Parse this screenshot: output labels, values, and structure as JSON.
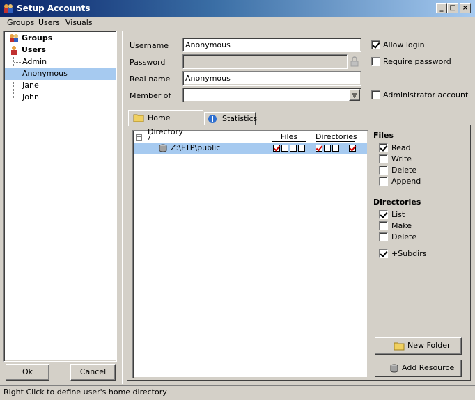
{
  "window": {
    "title": "Setup Accounts",
    "minimize": "_",
    "maximize": "□",
    "close": "×"
  },
  "menu": [
    "Groups",
    "Users",
    "Visuals"
  ],
  "tree": {
    "groups_label": "Groups",
    "users_label": "Users",
    "users": [
      "Admin",
      "Anonymous",
      "Jane",
      "John"
    ],
    "selected": "Anonymous"
  },
  "buttons": {
    "ok": "Ok",
    "cancel": "Cancel",
    "new_folder": "New Folder",
    "add_resource": "Add Resource"
  },
  "form": {
    "username_label": "Username",
    "username_value": "Anonymous",
    "password_label": "Password",
    "password_value": "",
    "realname_label": "Real name",
    "realname_value": "Anonymous",
    "memberof_label": "Member of",
    "memberof_value": "",
    "allow_login": {
      "label": "Allow login",
      "checked": true
    },
    "require_password": {
      "label": "Require password",
      "checked": false
    },
    "admin_account": {
      "label": "Administrator account",
      "checked": false
    }
  },
  "tabs": [
    "Home Directory",
    "Statistics"
  ],
  "dir_list": {
    "root": "/",
    "col_files": "Files",
    "col_dirs": "Directories",
    "entries": [
      {
        "path": "Z:\\FTP\\public",
        "files": [
          true,
          false,
          false,
          false
        ],
        "dirs": [
          true,
          false,
          false,
          true
        ]
      }
    ]
  },
  "perms": {
    "files_header": "Files",
    "files": [
      {
        "label": "Read",
        "checked": true
      },
      {
        "label": "Write",
        "checked": false
      },
      {
        "label": "Delete",
        "checked": false
      },
      {
        "label": "Append",
        "checked": false
      }
    ],
    "dirs_header": "Directories",
    "dirs": [
      {
        "label": "List",
        "checked": true
      },
      {
        "label": "Make",
        "checked": false
      },
      {
        "label": "Delete",
        "checked": false
      }
    ],
    "subdirs": {
      "label": "+Subdirs",
      "checked": true
    }
  },
  "status": "Right Click to define user's home directory"
}
